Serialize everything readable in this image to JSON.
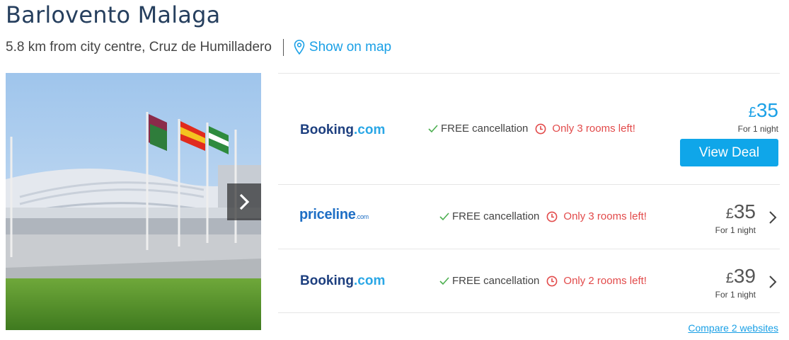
{
  "hotel": {
    "name": "Barlovento Malaga",
    "location": "5.8 km from city centre, Cruz de Humilladero",
    "show_map_label": "Show on map"
  },
  "photo": {
    "alt": "Hotel exterior with flags"
  },
  "deals": [
    {
      "provider": "Booking",
      "provider_suffix": ".com",
      "free_cancellation": "FREE cancellation",
      "availability": "Only 3 rooms left!",
      "currency": "£",
      "price": "35",
      "per_night": "For 1 night",
      "cta": "View Deal"
    },
    {
      "provider": "priceline",
      "provider_suffix": ".com",
      "free_cancellation": "FREE cancellation",
      "availability": "Only 3 rooms left!",
      "currency": "£",
      "price": "35",
      "per_night": "For 1 night"
    },
    {
      "provider": "Booking",
      "provider_suffix": ".com",
      "free_cancellation": "FREE cancellation",
      "availability": "Only 2 rooms left!",
      "currency": "£",
      "price": "39",
      "per_night": "For 1 night"
    }
  ],
  "compare_label": "Compare 2 websites",
  "colors": {
    "accent": "#1aa0e6",
    "button": "#0fa6e9",
    "warning": "#e24a4a",
    "success": "#4caf50",
    "title": "#263f5e"
  },
  "icons": {
    "map": "map-pin-icon",
    "check": "check-icon",
    "clock": "clock-icon",
    "next": "chevron-right-icon"
  }
}
